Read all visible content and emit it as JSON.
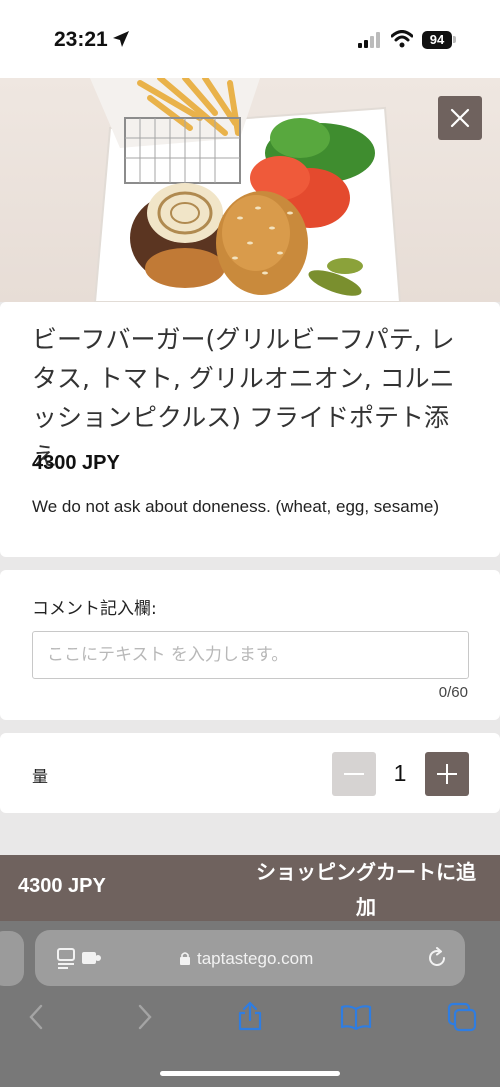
{
  "status_bar": {
    "time": "23:21",
    "battery": "94",
    "icons": [
      "location-arrow-icon",
      "cellular-signal-icon",
      "wifi-icon",
      "battery-icon"
    ]
  },
  "hero": {
    "image_subject": "beef burger with fries and pickles",
    "close_icon": "close-icon"
  },
  "item": {
    "title": "ビーフバーガー(グリルビーフパテ, レタス, トマト, グリルオニオン, コルニッションピクルス) フライドポテト添え",
    "price": "4300 JPY",
    "description": "We do not ask about doneness. (wheat, egg, sesame)"
  },
  "comment": {
    "label": "コメント記入欄:",
    "placeholder": "ここにテキスト を入力します。",
    "value": "",
    "counter": "0/60"
  },
  "quantity": {
    "label": "量",
    "value": "1"
  },
  "cart": {
    "total": "4300 JPY",
    "add_label": "ショッピングカートに追加"
  },
  "browser": {
    "url": "taptastego.com",
    "icons": [
      "reader-icon",
      "lock-icon",
      "reload-icon",
      "back-icon",
      "forward-icon",
      "share-icon",
      "bookmarks-icon",
      "tabs-icon"
    ]
  },
  "colors": {
    "accent": "#6f625e",
    "disabled_button": "#d6d3d2",
    "toolbar_blue": "#2f7de1"
  }
}
